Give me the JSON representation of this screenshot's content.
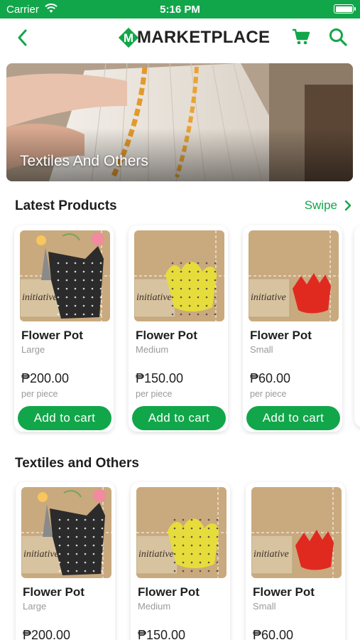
{
  "status_bar": {
    "carrier": "Carrier",
    "time": "5:16 PM"
  },
  "header": {
    "title": "MARKETPLACE",
    "logo_letter": "M"
  },
  "banner": {
    "title": "Textiles And Others"
  },
  "latest": {
    "title": "Latest Products",
    "swipe_label": "Swipe",
    "products": [
      {
        "name": "Flower Pot",
        "size": "Large",
        "price": "₱200.00",
        "unit": "per piece",
        "button": "Add to cart",
        "pot_color": "#2b2b2b"
      },
      {
        "name": "Flower Pot",
        "size": "Medium",
        "price": "₱150.00",
        "unit": "per piece",
        "button": "Add to cart",
        "pot_color": "#e6dc3c"
      },
      {
        "name": "Flower Pot",
        "size": "Small",
        "price": "₱60.00",
        "unit": "per piece",
        "button": "Add to cart",
        "pot_color": "#e02a20"
      }
    ]
  },
  "textiles": {
    "title": "Textiles and Others",
    "products": [
      {
        "name": "Flower Pot",
        "size": "Large",
        "price": "₱200.00",
        "pot_color": "#2b2b2b"
      },
      {
        "name": "Flower Pot",
        "size": "Medium",
        "price": "₱150.00",
        "pot_color": "#e6dc3c"
      },
      {
        "name": "Flower Pot",
        "size": "Small",
        "price": "₱60.00",
        "pot_color": "#e02a20"
      }
    ]
  },
  "colors": {
    "brand": "#12a64a",
    "text": "#1e1e1e",
    "muted": "#9a9a9a",
    "photo_bg": "#c9a97e"
  },
  "icons": [
    "wifi-icon",
    "battery-icon",
    "back-chevron-icon",
    "brand-logo-icon",
    "cart-icon",
    "search-icon",
    "chevron-right-icon"
  ]
}
